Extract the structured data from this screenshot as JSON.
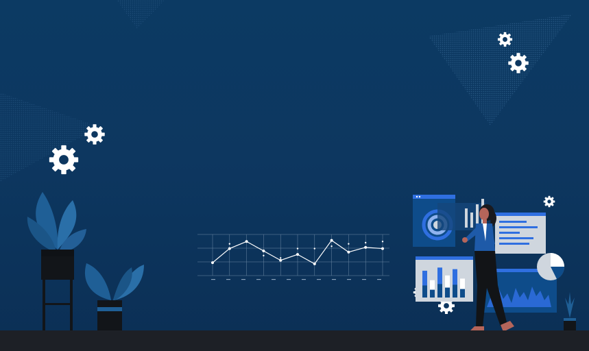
{
  "scene": {
    "colors": {
      "bg_top": "#0c3a63",
      "bg_bottom": "#0b2f55",
      "floor": "#1d2026",
      "gear": "#ffffff",
      "accent_blue": "#2f6fe0",
      "panel": "#cfd6de",
      "plant": "#1f5f96",
      "skin": "#b5655a",
      "suit": "#1e5aa8"
    },
    "line_chart": {
      "series_main": [
        22,
        46,
        58,
        42,
        26,
        36,
        20,
        60,
        40,
        48,
        46
      ],
      "series_dots": [
        null,
        54,
        58,
        34,
        30,
        46,
        46,
        50,
        54,
        56,
        58
      ]
    },
    "bar_panel": {
      "values": [
        0.85,
        0.55,
        0.95,
        0.7,
        0.9,
        0.6
      ]
    }
  }
}
